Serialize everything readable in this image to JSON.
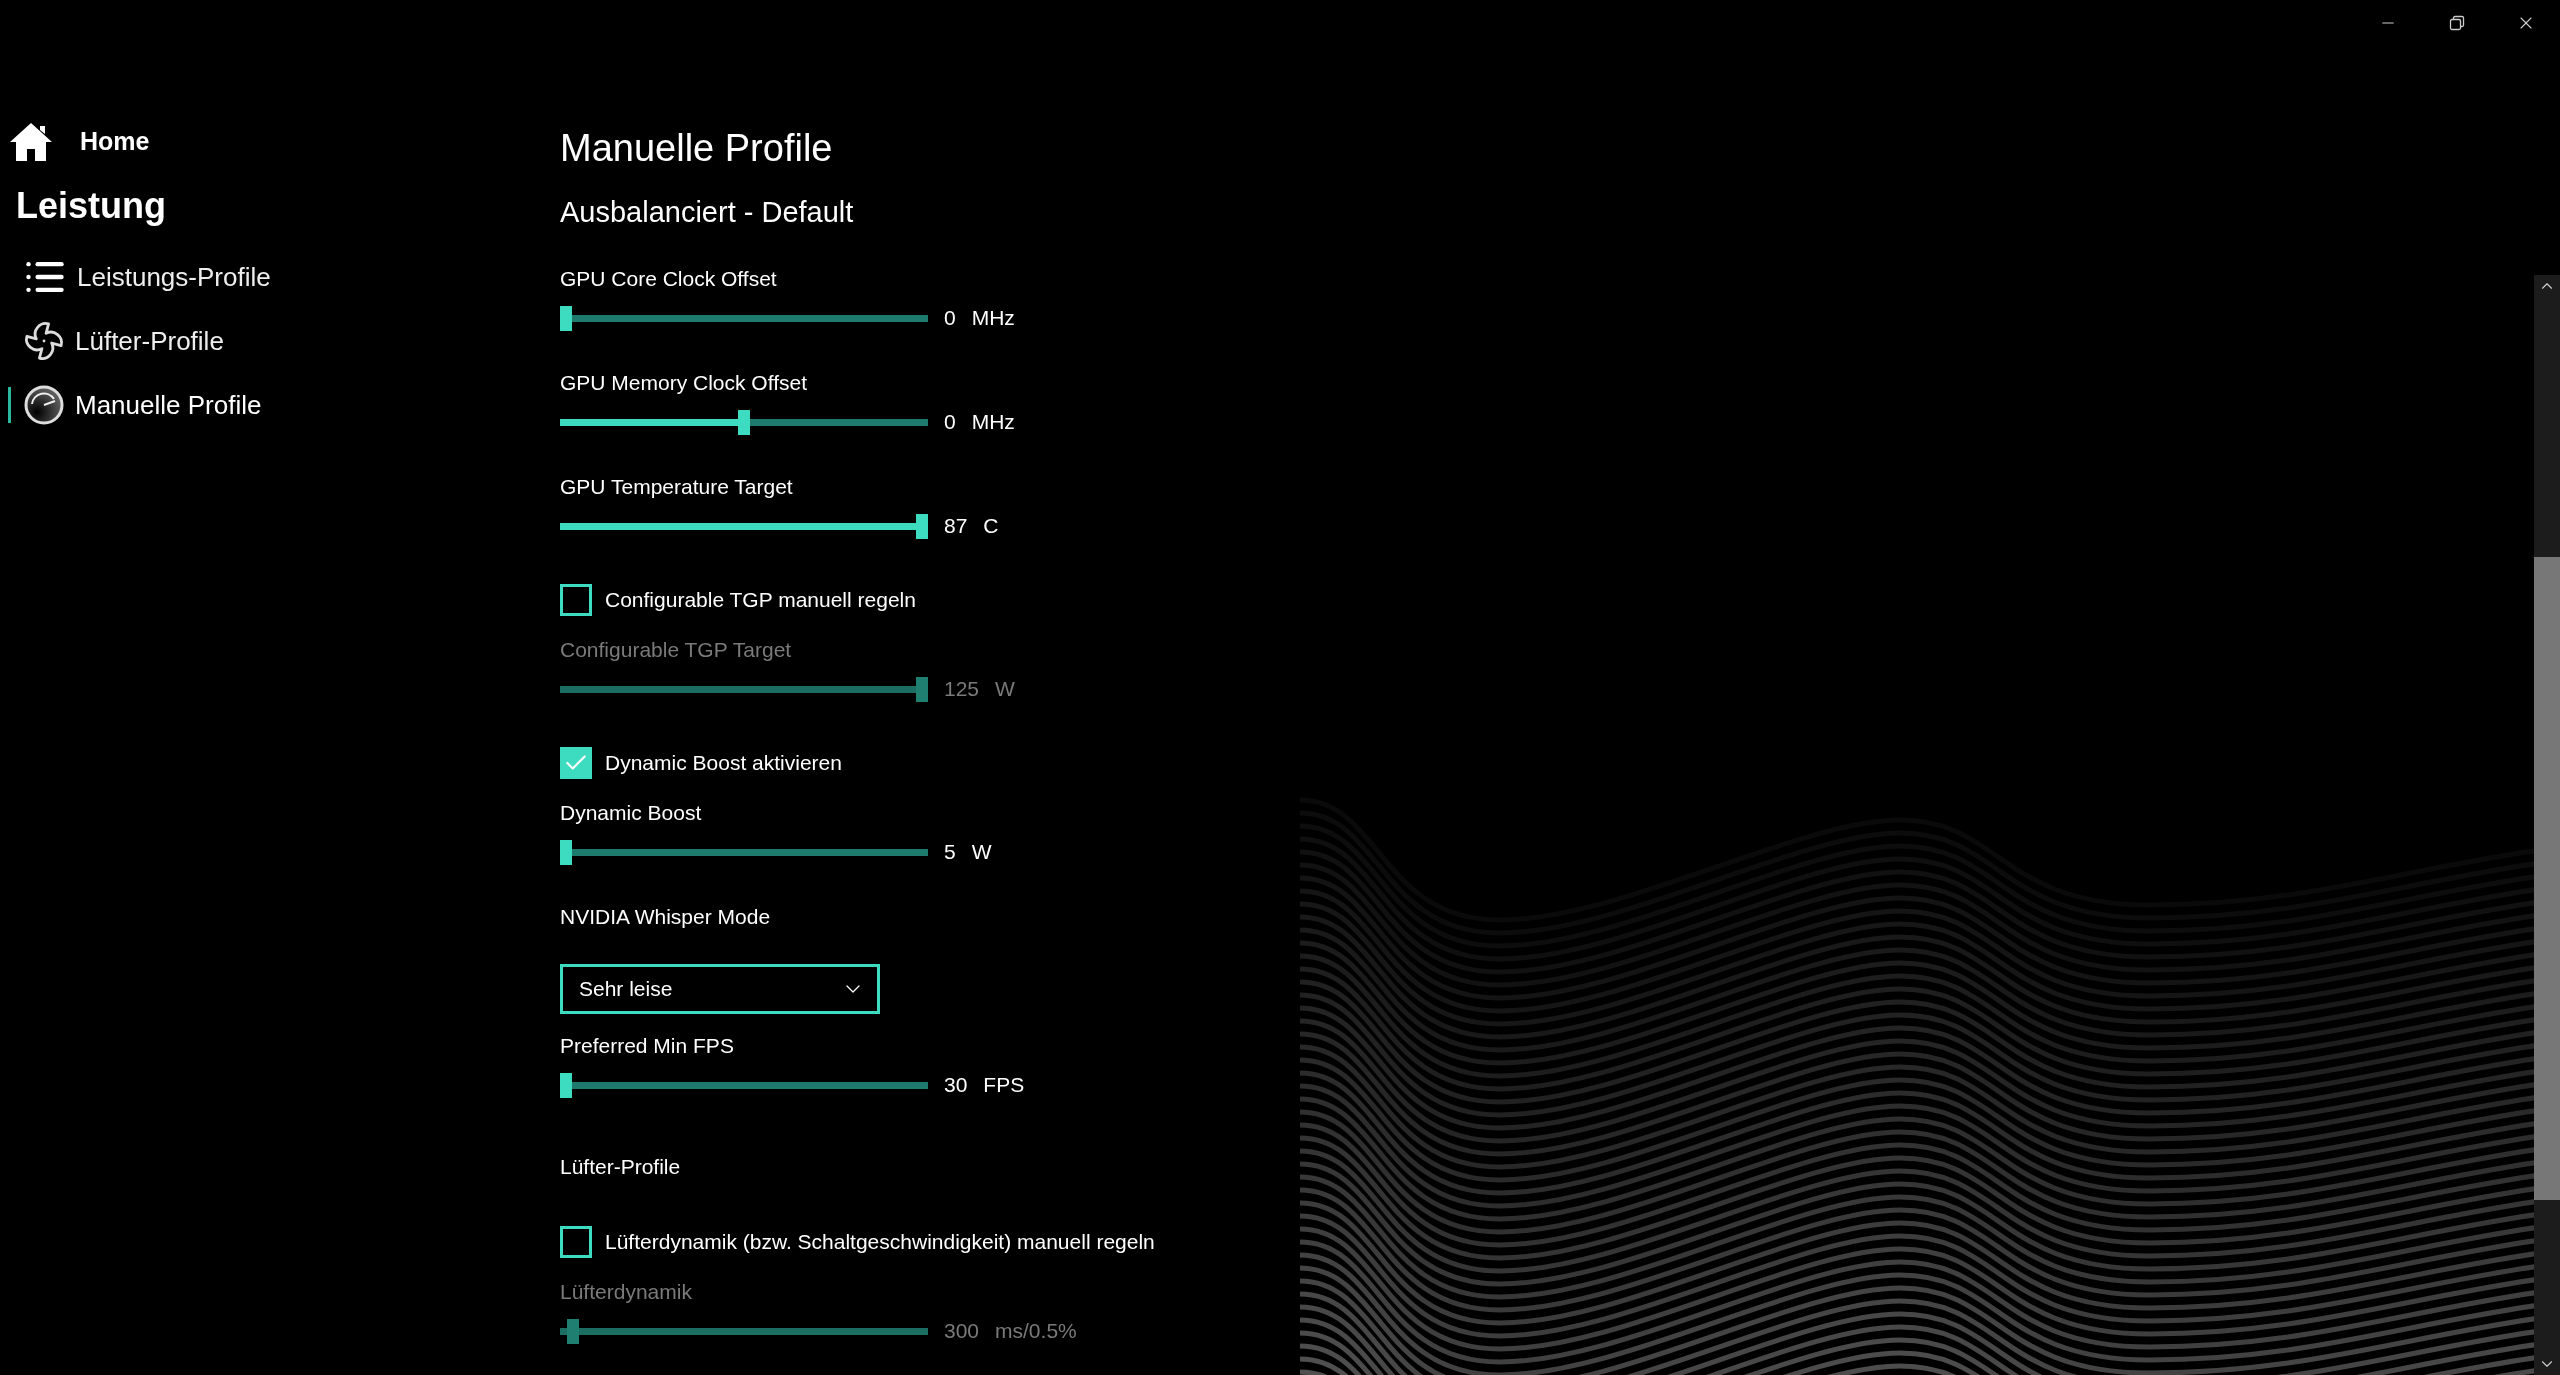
{
  "window_controls": [
    {
      "kind": "minimize"
    },
    {
      "kind": "restore"
    },
    {
      "kind": "close"
    }
  ],
  "sidebar": {
    "home": "Home",
    "section": "Leistung",
    "items": [
      {
        "label": "Leistungs-Profile",
        "kind": "list",
        "selected": false
      },
      {
        "label": "Lüfter-Profile",
        "kind": "fan",
        "selected": false
      },
      {
        "label": "Manuelle Profile",
        "kind": "gauge",
        "selected": true
      }
    ]
  },
  "page": {
    "title": "Manuelle Profile",
    "subtitle": "Ausbalanciert - Default",
    "controls": [
      {
        "kind": "slider",
        "label": "GPU Core Clock Offset",
        "level": 0,
        "value": "0",
        "unit": "MHz",
        "disabled": false
      },
      {
        "kind": "slider",
        "label": "GPU Memory Clock Offset",
        "level": 0.5,
        "value": "0",
        "unit": "MHz",
        "disabled": false
      },
      {
        "kind": "slider",
        "label": "GPU Temperature Target",
        "level": 1,
        "value": "87",
        "unit": "C",
        "disabled": false
      },
      {
        "kind": "checkbox",
        "label": "Configurable TGP manuell regeln",
        "checked": false
      },
      {
        "kind": "slider",
        "label": "Configurable TGP Target",
        "level": 1,
        "value": "125",
        "unit": "W",
        "disabled": true
      },
      {
        "kind": "checkbox",
        "label": "Dynamic Boost aktivieren",
        "checked": true
      },
      {
        "kind": "slider",
        "label": "Dynamic Boost",
        "level": 0,
        "value": "5",
        "unit": "W",
        "disabled": false
      },
      {
        "kind": "dropdown",
        "label": "NVIDIA Whisper Mode",
        "value": "Sehr leise"
      },
      {
        "kind": "slider",
        "label": "Preferred Min FPS",
        "level": 0,
        "value": "30",
        "unit": "FPS",
        "disabled": false
      },
      {
        "kind": "heading",
        "label": "Lüfter-Profile"
      },
      {
        "kind": "checkbox",
        "label": "Lüfterdynamik (bzw. Schaltgeschwindigkeit) manuell regeln",
        "checked": false
      },
      {
        "kind": "slider",
        "label": "Lüfterdynamik",
        "level": 0.02,
        "value": "300",
        "unit": "ms/0.5%",
        "disabled": true
      }
    ]
  }
}
